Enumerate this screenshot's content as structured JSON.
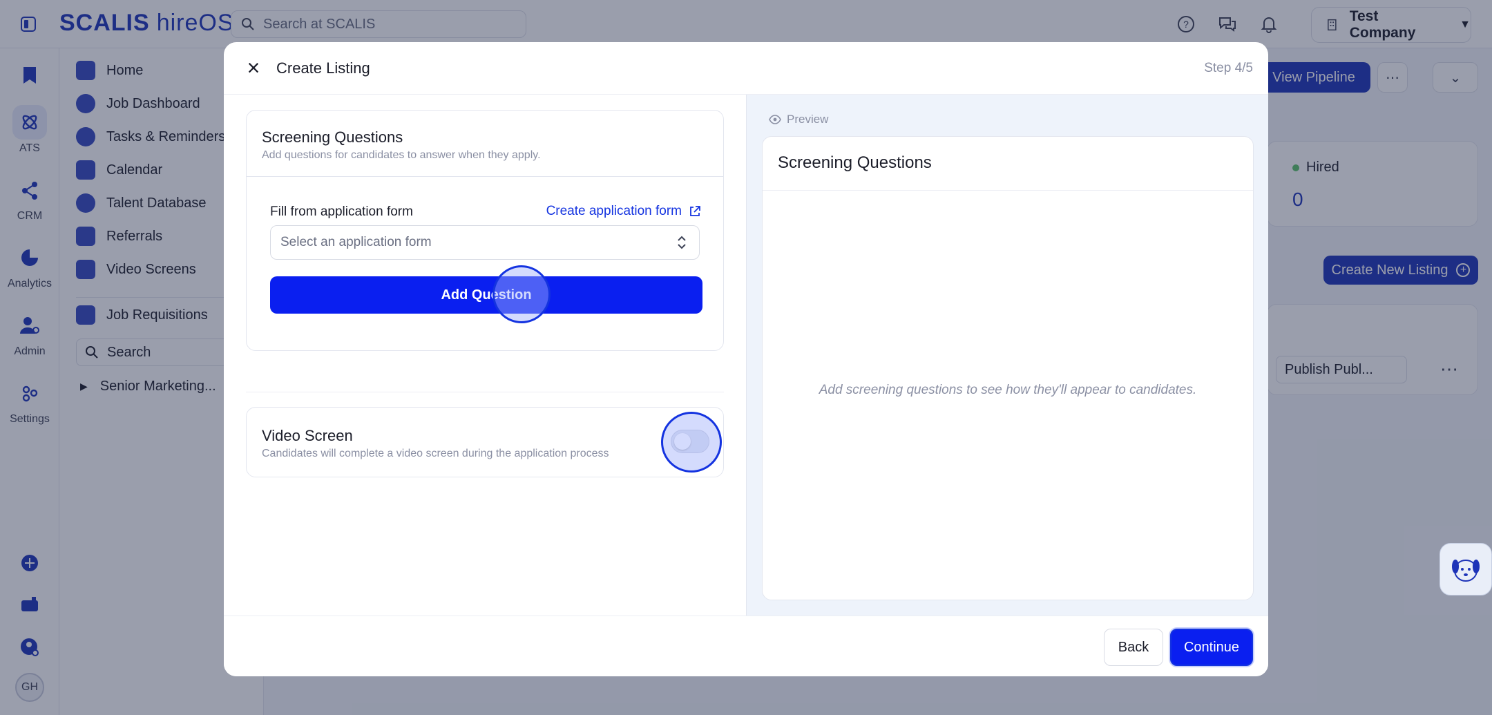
{
  "brand": {
    "name": "SCALIS",
    "product": "hireOS"
  },
  "topbar": {
    "search_placeholder": "Search at SCALIS",
    "company": "Test Company"
  },
  "rail": {
    "items": [
      {
        "label": ""
      },
      {
        "label": "ATS"
      },
      {
        "label": "CRM"
      },
      {
        "label": "Analytics"
      },
      {
        "label": "Admin"
      },
      {
        "label": "Settings"
      }
    ],
    "avatar_initials": "GH"
  },
  "nav": {
    "items": [
      {
        "label": "Home"
      },
      {
        "label": "Job Dashboard"
      },
      {
        "label": "Tasks & Reminders"
      },
      {
        "label": "Calendar"
      },
      {
        "label": "Talent Database"
      },
      {
        "label": "Referrals"
      },
      {
        "label": "Video Screens"
      },
      {
        "label": "Job Requisitions"
      }
    ],
    "search_label": "Search",
    "tree_item": "Senior Marketing..."
  },
  "background": {
    "view_pipeline": "View Pipeline",
    "hired_label": "Hired",
    "hired_value": "0",
    "create_new_listing": "Create New Listing",
    "publish_select": "Publish Publ..."
  },
  "modal": {
    "title": "Create Listing",
    "step": "Step 4/5",
    "screening": {
      "title": "Screening Questions",
      "subtitle": "Add questions for candidates to answer when they apply.",
      "fill_label": "Fill from application form",
      "create_link": "Create application form",
      "select_placeholder": "Select an application form",
      "add_button": "Add Question"
    },
    "video_screen": {
      "title": "Video Screen",
      "subtitle": "Candidates will complete a video screen during the application process",
      "enabled": false
    },
    "preview": {
      "label": "Preview",
      "title": "Screening Questions",
      "empty_text": "Add screening questions to see how they'll appear to candidates."
    },
    "footer": {
      "back": "Back",
      "continue": "Continue"
    }
  },
  "colors": {
    "primary": "#0a1ff0",
    "brand": "#1d33b8",
    "overlay": "rgba(30,40,70,0.45)"
  }
}
